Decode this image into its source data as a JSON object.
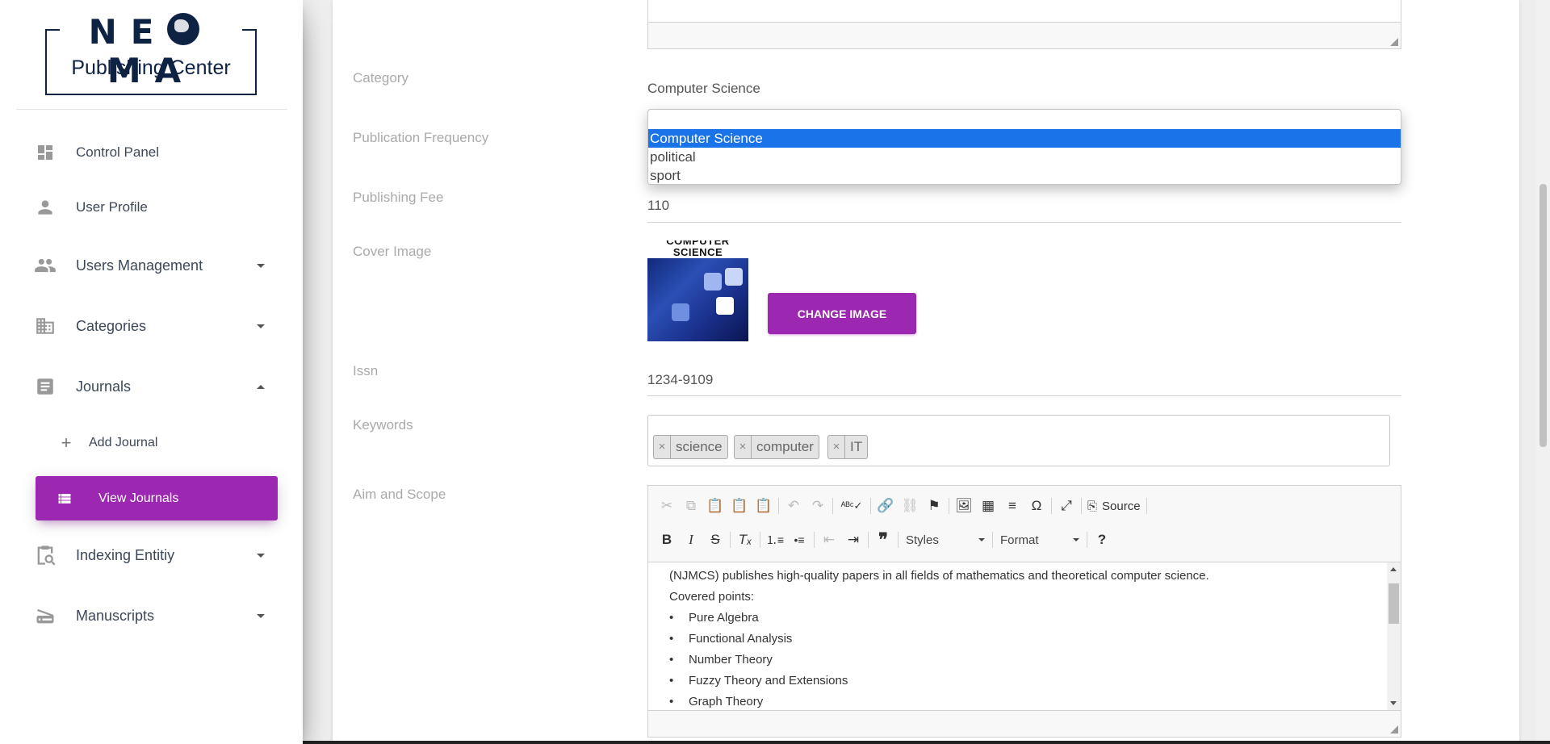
{
  "brand": {
    "title": "NEOMA",
    "title_left": "NE",
    "title_right": "MA",
    "subtitle": "Publishing Center"
  },
  "sidebar": {
    "items": [
      {
        "label": "Control Panel",
        "icon": "dashboard-icon"
      },
      {
        "label": "User Profile",
        "icon": "person-icon"
      },
      {
        "label": "Users Management",
        "icon": "people-icon"
      },
      {
        "label": "Categories",
        "icon": "building-icon"
      },
      {
        "label": "Journals",
        "icon": "article-icon"
      },
      {
        "label": "Add Journal",
        "icon": "plus-icon"
      },
      {
        "label": "View Journals",
        "icon": "list-icon",
        "active": true
      },
      {
        "label": "Indexing Entitiy",
        "icon": "clipboard-search-icon"
      },
      {
        "label": "Manuscripts",
        "icon": "scanner-icon"
      }
    ]
  },
  "form": {
    "labels": {
      "category": "Category",
      "frequency": "Publication Frequency",
      "fee": "Publishing Fee",
      "cover": "Cover Image",
      "issn": "Issn",
      "keywords": "Keywords",
      "aim": "Aim and Scope"
    },
    "category_value": "Computer Science",
    "category_options": [
      "",
      "Computer Science",
      "political",
      "sport"
    ],
    "fee_value": "110",
    "issn_value": "1234-9109",
    "cover_title": "COMPUTER SCIENCE",
    "change_image_label": "CHANGE IMAGE",
    "keywords": [
      "science",
      "computer",
      "IT"
    ],
    "tag_remove": "×"
  },
  "editor": {
    "source_label": "Source",
    "styles_label": "Styles",
    "format_label": "Format",
    "help_label": "?",
    "content": {
      "intro": "(NJMCS) publishes high-quality papers in all fields of mathematics and theoretical computer science.",
      "covered": "Covered points:",
      "points": [
        "Pure Algebra",
        "Functional Analysis",
        "Number Theory",
        "Fuzzy Theory and Extensions",
        "Graph Theory"
      ]
    }
  },
  "colors": {
    "accent": "#9c27b0",
    "brand_navy": "#0e2244",
    "select_highlight": "#1a73e8"
  }
}
